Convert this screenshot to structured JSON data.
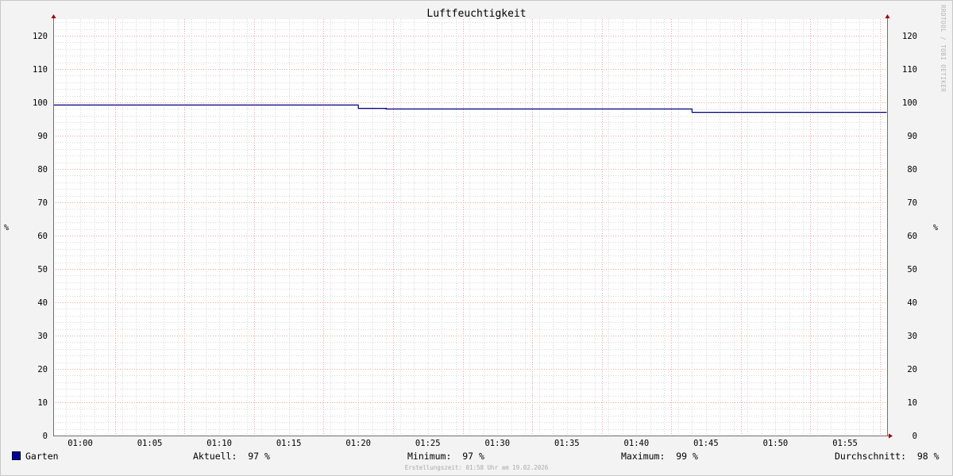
{
  "chart_data": {
    "type": "line",
    "title": "Luftfeuchtigkeit",
    "ylabel": "%",
    "ylim": [
      0,
      125
    ],
    "yticks": [
      0,
      10,
      20,
      30,
      40,
      50,
      60,
      70,
      80,
      90,
      100,
      110,
      120
    ],
    "xticks": [
      "01:00",
      "01:05",
      "01:10",
      "01:15",
      "01:20",
      "01:25",
      "01:30",
      "01:35",
      "01:40",
      "01:45",
      "01:50",
      "01:55"
    ],
    "grid": true,
    "series": [
      {
        "name": "Garten",
        "color": "#00007f",
        "points": [
          {
            "t": "00:58",
            "v": 99.2
          },
          {
            "t": "01:20",
            "v": 99.2
          },
          {
            "t": "01:20",
            "v": 98.2
          },
          {
            "t": "01:22",
            "v": 98.2
          },
          {
            "t": "01:22",
            "v": 98.0
          },
          {
            "t": "01:44",
            "v": 98.0
          },
          {
            "t": "01:44",
            "v": 97.0
          },
          {
            "t": "01:58",
            "v": 97.0
          }
        ]
      }
    ]
  },
  "legend": {
    "series_name": "Garten",
    "swatch_color": "#0000a0",
    "aktuell": "Aktuell:  97 %",
    "minimum": "Minimum:  97 %",
    "maximum": "Maximum:  99 %",
    "durchschnitt": "Durchschnitt:  98 %"
  },
  "footer": "Erstellungszeit: 01:58 Uhr am 19.02.2026",
  "watermark": "RRDTOOL / TOBI OETIKER"
}
